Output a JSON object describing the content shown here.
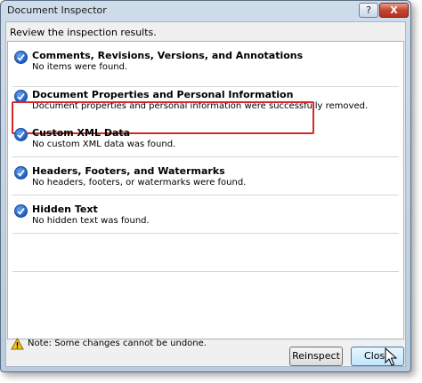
{
  "window": {
    "title": "Document Inspector"
  },
  "titlebar_buttons": {
    "help": "?",
    "close": "X"
  },
  "instruction": "Review the inspection results.",
  "results": [
    {
      "title": "Comments, Revisions, Versions, and Annotations",
      "description": "No items were found."
    },
    {
      "title": "Document Properties and Personal Information",
      "description": "Document properties and personal information were successfully removed."
    },
    {
      "title": "Custom XML Data",
      "description": "No custom XML data was found."
    },
    {
      "title": "Headers, Footers, and Watermarks",
      "description": "No headers, footers, or watermarks were found."
    },
    {
      "title": "Hidden Text",
      "description": "No hidden text was found."
    }
  ],
  "footer": {
    "note": "Note: Some changes cannot be undone.",
    "reinspect_label": "Reinspect",
    "close_label": "Close"
  },
  "colors": {
    "highlight": "#d62828",
    "check": "#1d5bbd"
  },
  "icons": [
    "checkmark-icon",
    "warning-icon",
    "pointer-cursor-icon"
  ]
}
